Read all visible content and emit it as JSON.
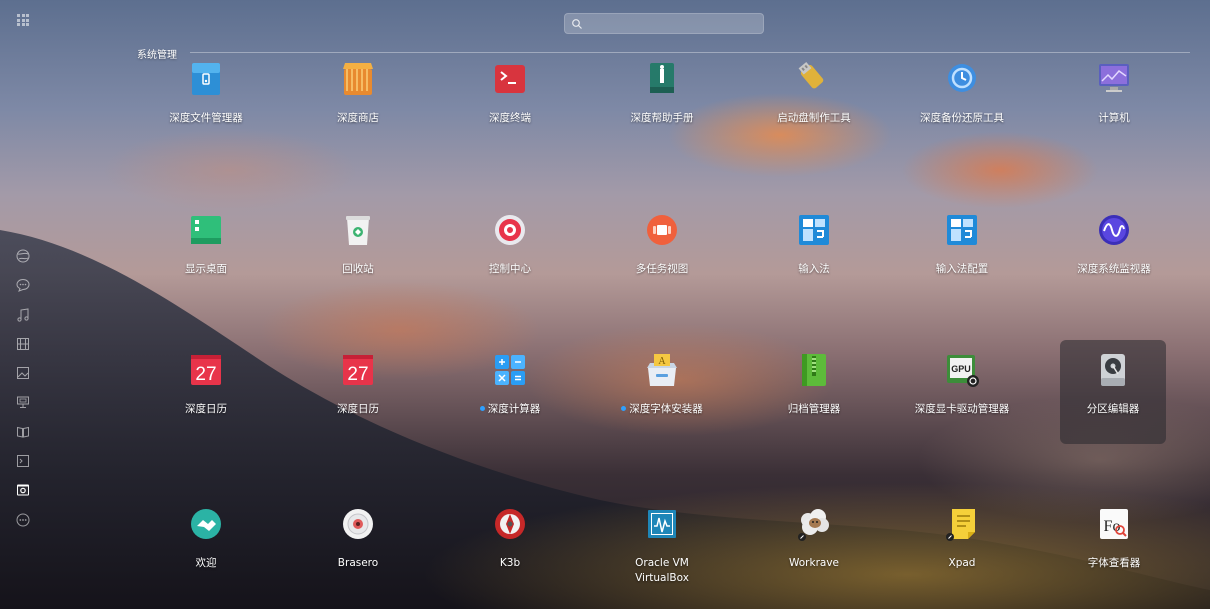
{
  "search": {
    "placeholder": ""
  },
  "category": {
    "title": "系统管理"
  },
  "sidebar": {
    "items": [
      {
        "name": "internet-icon"
      },
      {
        "name": "chat-icon"
      },
      {
        "name": "music-icon"
      },
      {
        "name": "video-icon"
      },
      {
        "name": "image-icon"
      },
      {
        "name": "game-icon"
      },
      {
        "name": "office-icon"
      },
      {
        "name": "developer-icon"
      },
      {
        "name": "system-icon",
        "active": true
      },
      {
        "name": "others-icon"
      }
    ]
  },
  "apps": [
    {
      "label": "深度文件管理器",
      "icon": "file-manager-icon"
    },
    {
      "label": "深度商店",
      "icon": "app-store-icon"
    },
    {
      "label": "深度终端",
      "icon": "terminal-icon"
    },
    {
      "label": "深度帮助手册",
      "icon": "manual-icon"
    },
    {
      "label": "启动盘制作工具",
      "icon": "boot-maker-icon"
    },
    {
      "label": "深度备份还原工具",
      "icon": "backup-icon"
    },
    {
      "label": "计算机",
      "icon": "computer-icon"
    },
    {
      "label": "显示桌面",
      "icon": "show-desktop-icon"
    },
    {
      "label": "回收站",
      "icon": "trash-icon"
    },
    {
      "label": "控制中心",
      "icon": "control-center-icon"
    },
    {
      "label": "多任务视图",
      "icon": "multitask-icon"
    },
    {
      "label": "输入法",
      "icon": "input-method-icon"
    },
    {
      "label": "输入法配置",
      "icon": "input-config-icon"
    },
    {
      "label": "深度系统监视器",
      "icon": "system-monitor-icon"
    },
    {
      "label": "深度日历",
      "icon": "calendar-icon",
      "day": "27"
    },
    {
      "label": "深度日历",
      "icon": "calendar-icon",
      "day": "27"
    },
    {
      "label": "深度计算器",
      "icon": "calculator-icon",
      "new": true
    },
    {
      "label": "深度字体安装器",
      "icon": "font-installer-icon",
      "new": true
    },
    {
      "label": "归档管理器",
      "icon": "archive-icon"
    },
    {
      "label": "深度显卡驱动管理器",
      "icon": "gpu-driver-icon",
      "badge": "GPU"
    },
    {
      "label": "分区编辑器",
      "icon": "partition-editor-icon",
      "selected": true
    },
    {
      "label": "欢迎",
      "icon": "welcome-icon"
    },
    {
      "label": "Brasero",
      "icon": "brasero-icon"
    },
    {
      "label": "K3b",
      "icon": "k3b-icon"
    },
    {
      "label": "Oracle VM VirtualBox",
      "icon": "virtualbox-icon"
    },
    {
      "label": "Workrave",
      "icon": "workrave-icon"
    },
    {
      "label": "Xpad",
      "icon": "xpad-icon"
    },
    {
      "label": "字体查看器",
      "icon": "font-viewer-icon",
      "glyph": "Fo"
    }
  ],
  "colors": {
    "accent": "#2ea0ff",
    "calendar_red": "#e8344a"
  }
}
